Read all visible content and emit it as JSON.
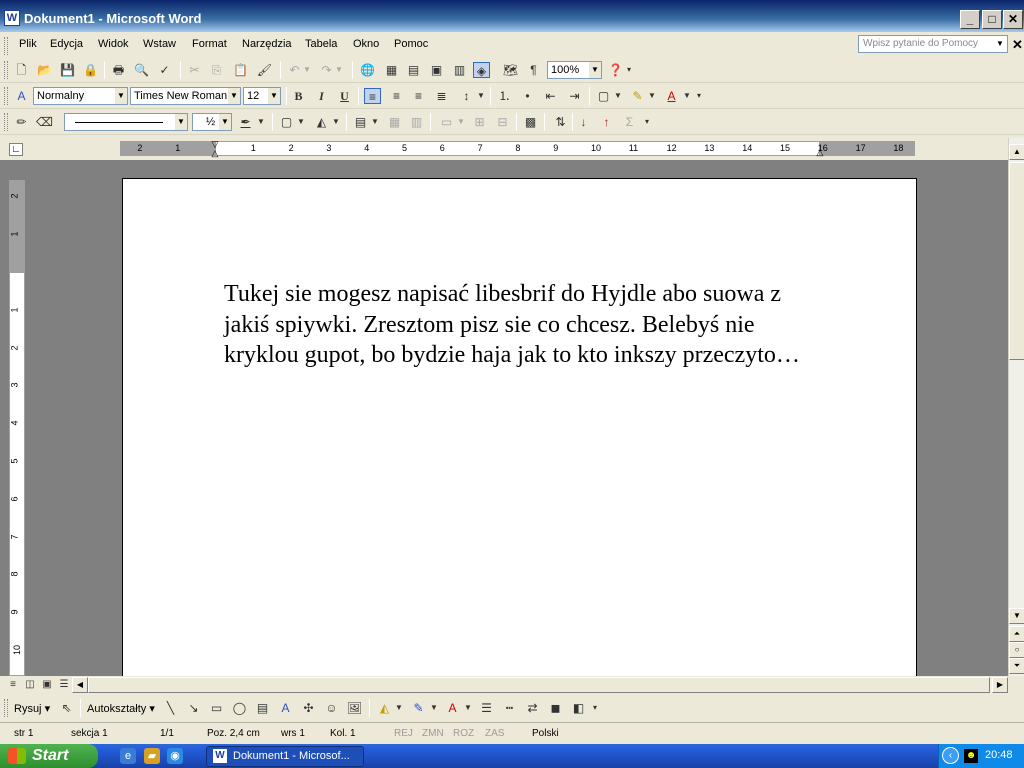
{
  "window": {
    "title": "Dokument1 - Microsoft Word",
    "app_icon": "W"
  },
  "menu": {
    "items": [
      "Plik",
      "Edycja",
      "Widok",
      "Wstaw",
      "Format",
      "Narzędzia",
      "Tabela",
      "Okno",
      "Pomoc"
    ],
    "help_placeholder": "Wpisz pytanie do Pomocy"
  },
  "standard_toolbar": {
    "zoom": "100%"
  },
  "formatting_toolbar": {
    "style": "Normalny",
    "font": "Times New Roman",
    "size": "12"
  },
  "drawing_lines_toolbar": {
    "line_width": "½"
  },
  "ruler": {
    "numbers": [
      "2",
      "1",
      "1",
      "2",
      "3",
      "4",
      "5",
      "6",
      "7",
      "8",
      "9",
      "10",
      "11",
      "12",
      "13",
      "14",
      "15",
      "16",
      "17",
      "18"
    ]
  },
  "vruler": {
    "numbers": [
      "2",
      "1",
      "1",
      "2",
      "3",
      "4",
      "5",
      "6",
      "7",
      "8",
      "9",
      "10"
    ]
  },
  "document": {
    "text": "Tukej sie mogesz napisać libesbrif do Hyjdle abo suowa z jakiś spiywki. Zresztom pisz sie co chcesz. Belebyś nie kryklou gupot, bo bydzie haja jak to kto inkszy przeczyto…"
  },
  "drawing_toolbar": {
    "draw_label": "Rysuj",
    "autoshapes_label": "Autokształty"
  },
  "status": {
    "page": "str 1",
    "section": "sekcja 1",
    "pages": "1/1",
    "position": "Poz. 2,4 cm",
    "line": "wrs 1",
    "column": "Kol. 1",
    "rec": "REJ",
    "trk": "ZMN",
    "ext": "ROZ",
    "ovr": "ZAS",
    "language": "Polski"
  },
  "taskbar": {
    "start": "Start",
    "task": "Dokument1 - Microsof...",
    "clock": "20:48"
  }
}
